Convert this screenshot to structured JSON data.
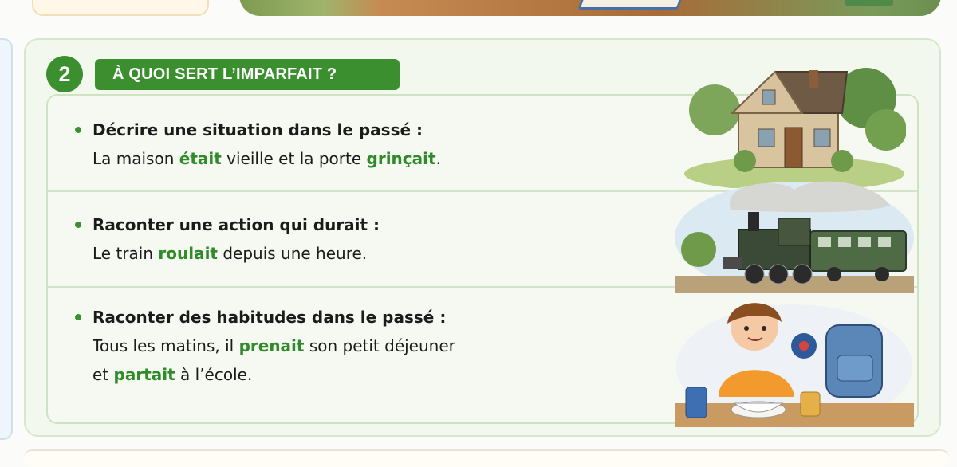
{
  "section": {
    "number": "2",
    "title": "À QUOI SERT L’IMPARFAIT ?"
  },
  "rules": [
    {
      "heading": "Décrire une situation dans le passé :",
      "example_lines": [
        [
          {
            "text": "La maison ",
            "verb": false
          },
          {
            "text": "était",
            "verb": true
          },
          {
            "text": " vieille et la porte ",
            "verb": false
          },
          {
            "text": "grinçait",
            "verb": true
          },
          {
            "text": ".",
            "verb": false
          }
        ]
      ],
      "illustration": "house-illustration"
    },
    {
      "heading": "Raconter une action qui durait :",
      "example_lines": [
        [
          {
            "text": "Le train ",
            "verb": false
          },
          {
            "text": "roulait",
            "verb": true
          },
          {
            "text": " depuis une heure.",
            "verb": false
          }
        ]
      ],
      "illustration": "train-illustration"
    },
    {
      "heading": "Raconter des habitudes dans le passé :",
      "example_lines": [
        [
          {
            "text": "Tous les matins, il ",
            "verb": false
          },
          {
            "text": "prenait",
            "verb": true
          },
          {
            "text": " son petit déjeuner",
            "verb": false
          }
        ],
        [
          {
            "text": "et ",
            "verb": false
          },
          {
            "text": "partait",
            "verb": true
          },
          {
            "text": " à l’école.",
            "verb": false
          }
        ]
      ],
      "illustration": "boy-breakfast-illustration"
    }
  ],
  "colors": {
    "accent_green": "#3c8f2f",
    "verb_green": "#2f8a2a",
    "panel_bg": "#f3f8ef",
    "panel_border": "#d6e7cc"
  },
  "icons": [
    "bullet-dot",
    "house-illustration",
    "train-illustration",
    "boy-breakfast-illustration"
  ]
}
